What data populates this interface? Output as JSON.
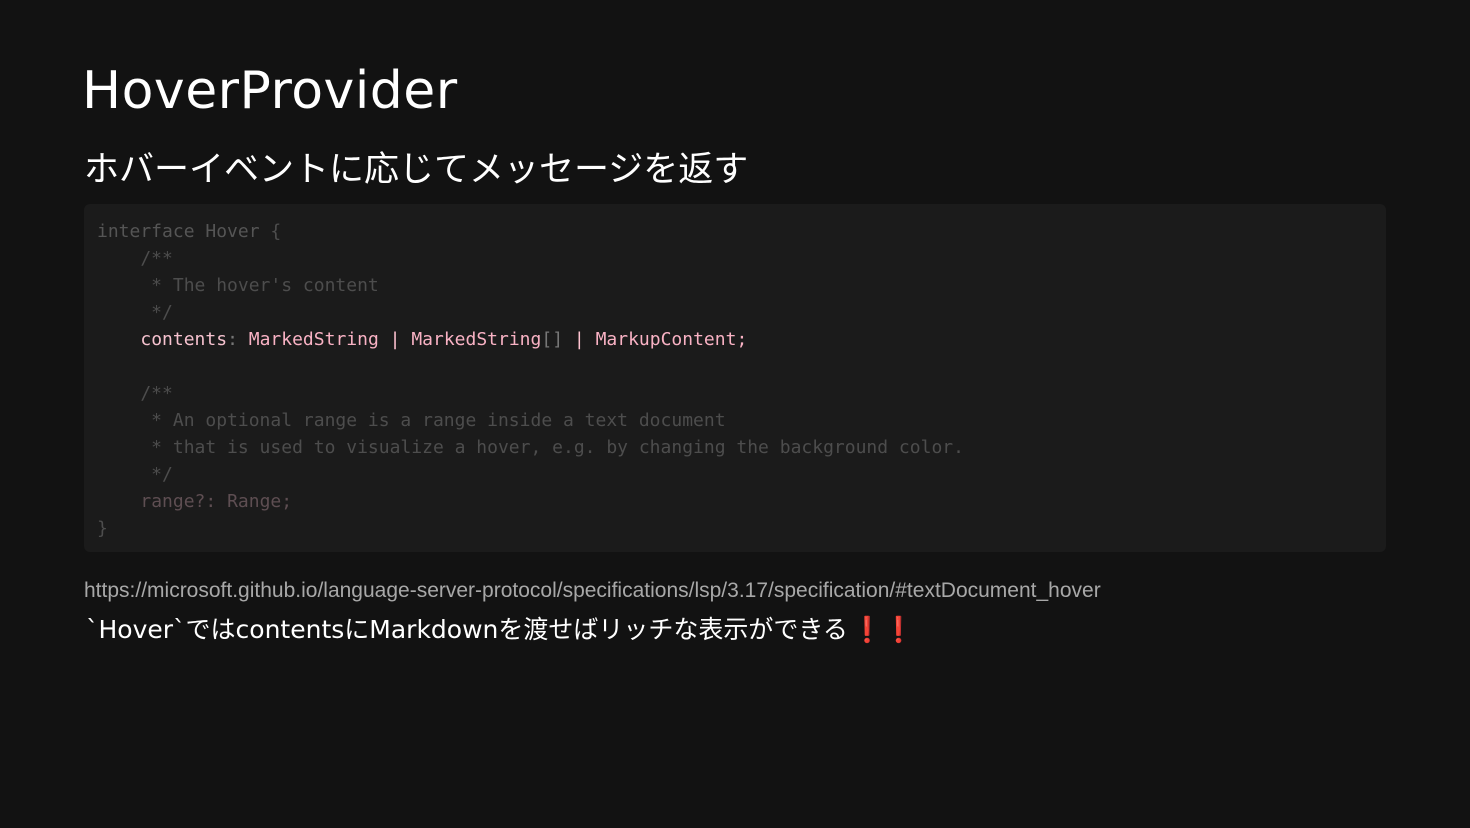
{
  "slide": {
    "title": "HoverProvider",
    "subtitle": "ホバーイベントに応じてメッセージを返す"
  },
  "code": {
    "l1_kw": "interface",
    "l1_name": " Hover ",
    "l1_brace": "{",
    "l2": "    /**",
    "l3": "     * The hover's content",
    "l4": "     */",
    "l5_indent": "    ",
    "l5_prop": "contents",
    "l5_colon": ": ",
    "l5_t1": "MarkedString",
    "l5_or1": " | ",
    "l5_t2": "MarkedString",
    "l5_arr": "[]",
    "l5_or2": " | ",
    "l5_t3": "MarkupContent;",
    "l6": "",
    "l7": "    /**",
    "l8": "     * An optional range is a range inside a text document",
    "l9": "     * that is used to visualize a hover, e.g. by changing the background color.",
    "l10": "     */",
    "l11_indent": "    ",
    "l11_prop": "range?: ",
    "l11_type": "Range;",
    "l12": "}"
  },
  "link": {
    "text": "https://microsoft.github.io/language-server-protocol/specifications/lsp/3.17/specification/#textDocument_hover"
  },
  "note": {
    "text": "`Hover`ではcontentsにMarkdownを渡せばリッチな表示ができる",
    "emoji": "❗❗"
  },
  "colors": {
    "background": "#121212",
    "code_background": "#1b1b1b",
    "highlight": "#f9b2c4",
    "emoji_red": "#e0202a"
  }
}
